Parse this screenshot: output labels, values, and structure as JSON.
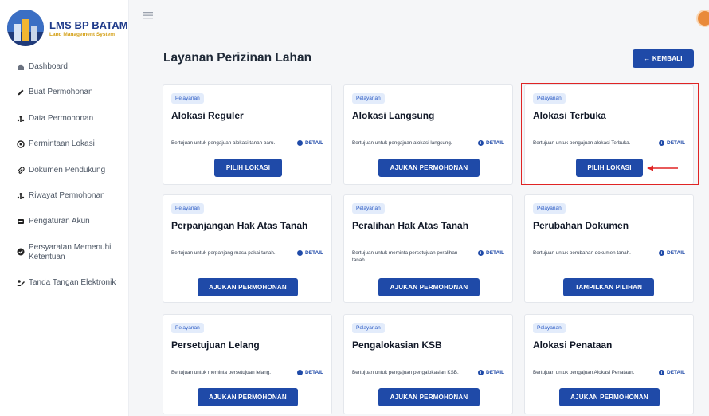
{
  "brand": {
    "title": "LMS BP BATAM",
    "subtitle": "Land Management System"
  },
  "sidebar": {
    "items": [
      {
        "label": "Dashboard",
        "icon": "home-icon"
      },
      {
        "label": "Buat Permohonan",
        "icon": "pencil-icon"
      },
      {
        "label": "Data Permohonan",
        "icon": "data-icon"
      },
      {
        "label": "Permintaan Lokasi",
        "icon": "location-icon"
      },
      {
        "label": "Dokumen Pendukung",
        "icon": "paperclip-icon"
      },
      {
        "label": "Riwayat Permohonan",
        "icon": "history-icon"
      },
      {
        "label": "Pengaturan Akun",
        "icon": "user-settings-icon"
      },
      {
        "label": "Persyaratan Memenuhi Ketentuan",
        "icon": "check-circle-icon"
      },
      {
        "label": "Tanda Tangan Elektronik",
        "icon": "signature-icon"
      }
    ]
  },
  "header": {
    "title": "Layanan Perizinan Lahan",
    "back_label": "← KEMBALI"
  },
  "cards": [
    {
      "badge": "Pelayanan",
      "title": "Alokasi Reguler",
      "desc": "Bertujuan untuk pengajuan alokasi tanah baru.",
      "detail": "DETAIL",
      "action": "PILIH LOKASI"
    },
    {
      "badge": "Pelayanan",
      "title": "Alokasi Langsung",
      "desc": "Bertujuan untuk pengajuan alokasi langsung.",
      "detail": "DETAIL",
      "action": "AJUKAN PERMOHONAN"
    },
    {
      "badge": "Pelayanan",
      "title": "Alokasi Terbuka",
      "desc": "Bertujuan untuk pengajuan alokasi Terbuka.",
      "detail": "DETAIL",
      "action": "PILIH LOKASI"
    },
    {
      "badge": "Pelayanan",
      "title": "Perpanjangan Hak Atas Tanah",
      "desc": "Bertujuan untuk perpanjang masa pakai tanah.",
      "detail": "DETAIL",
      "action": "AJUKAN PERMOHONAN"
    },
    {
      "badge": "Pelayanan",
      "title": "Peralihan Hak Atas Tanah",
      "desc": "Bertujuan untuk meminta persetujuan peralihan tanah.",
      "detail": "DETAIL",
      "action": "AJUKAN PERMOHONAN"
    },
    {
      "badge": "Pelayanan",
      "title": "Perubahan Dokumen",
      "desc": "Bertujuan untuk perubahan dokumen tanah.",
      "detail": "DETAIL",
      "action": "TAMPILKAN PILIHAN"
    },
    {
      "badge": "Pelayanan",
      "title": "Persetujuan Lelang",
      "desc": "Bertujuan untuk meminta persetujuan lelang.",
      "detail": "DETAIL",
      "action": "AJUKAN PERMOHONAN"
    },
    {
      "badge": "Pelayanan",
      "title": "Pengalokasian KSB",
      "desc": "Bertujuan untuk pengajuan pengalokasian KSB.",
      "detail": "DETAIL",
      "action": "AJUKAN PERMOHONAN"
    },
    {
      "badge": "Pelayanan",
      "title": "Alokasi Penataan",
      "desc": "Bertujuan untuk pengajuan Alokasi Penataan.",
      "detail": "DETAIL",
      "action": "AJUKAN PERMOHONAN"
    }
  ],
  "colors": {
    "primary": "#1f4aa8",
    "highlight": "#e02424",
    "badge_bg": "#e3ecfb"
  }
}
